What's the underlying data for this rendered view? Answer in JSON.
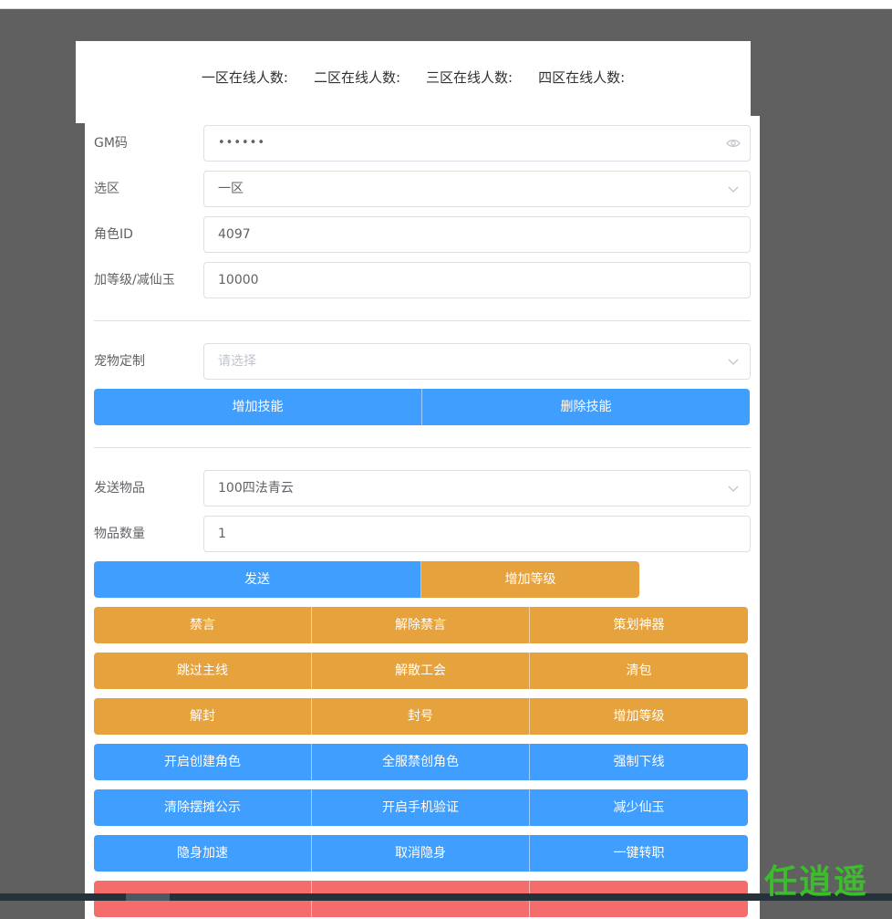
{
  "online": {
    "zone1": "一区在线人数:",
    "zone2": "二区在线人数:",
    "zone3": "三区在线人数:",
    "zone4": "四区在线人数:"
  },
  "form": {
    "gm_code": {
      "label": "GM码",
      "value": "••••••",
      "icon": "eye-icon"
    },
    "zone": {
      "label": "选区",
      "value": "一区",
      "icon": "chevron-down-icon"
    },
    "role_id": {
      "label": "角色ID",
      "value": "4097"
    },
    "level_jade": {
      "label": "加等级/减仙玉",
      "value": "10000"
    },
    "pet": {
      "label": "宠物定制",
      "placeholder": "请选择",
      "icon": "chevron-down-icon"
    },
    "item": {
      "label": "发送物品",
      "value": "100四法青云",
      "icon": "chevron-down-icon"
    },
    "item_count": {
      "label": "物品数量",
      "value": "1"
    }
  },
  "skill_buttons": {
    "add": "增加技能",
    "remove": "删除技能"
  },
  "send_buttons": {
    "send": "发送",
    "add_level": "增加等级"
  },
  "action_rows": [
    [
      "禁言",
      "解除禁言",
      "策划神器"
    ],
    [
      "跳过主线",
      "解散工会",
      "清包"
    ],
    [
      "解封",
      "封号",
      "增加等级"
    ],
    [
      "开启创建角色",
      "全服禁创角色",
      "强制下线"
    ],
    [
      "清除摆摊公示",
      "开启手机验证",
      "减少仙玉"
    ],
    [
      "隐身加速",
      "取消隐身",
      "一键转职"
    ]
  ],
  "colors": {
    "blue": "#409eff",
    "orange": "#e6a23c",
    "red": "#f56c6c",
    "watermark": "#3bbd2c"
  },
  "watermark": "任逍遥"
}
